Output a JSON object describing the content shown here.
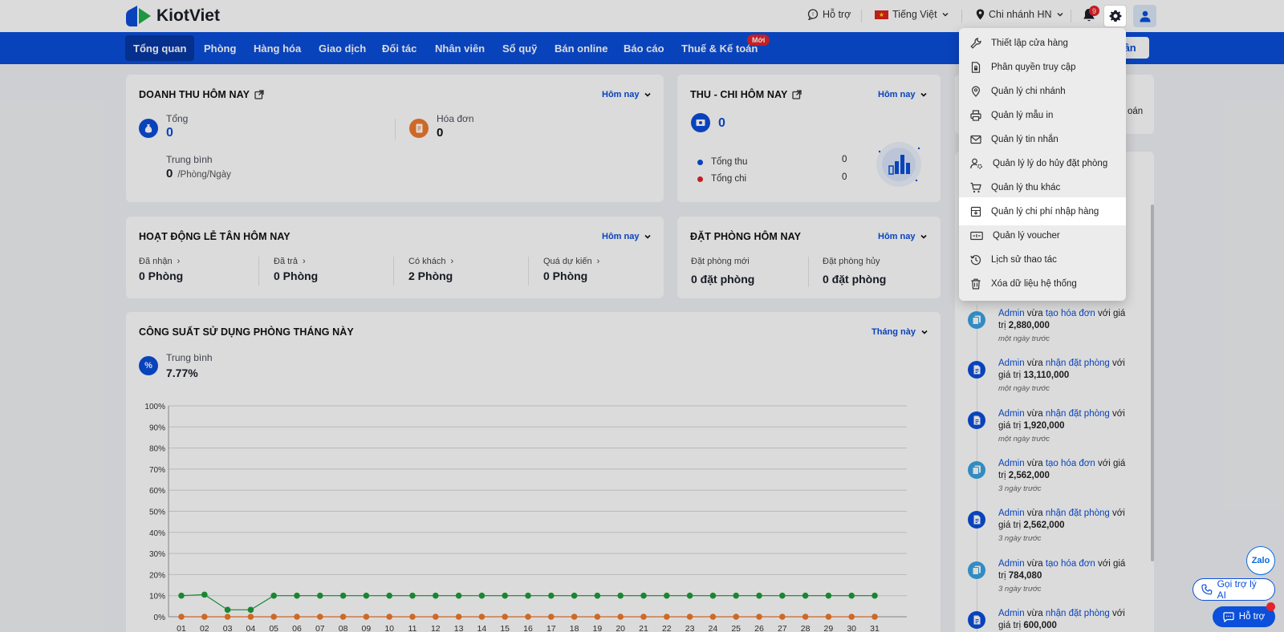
{
  "topbar": {
    "brand": "KiotViet",
    "support": "Hỗ trợ",
    "language": "Tiếng Việt",
    "branch": "Chi nhánh HN",
    "notif_count": "9"
  },
  "nav": {
    "items": [
      "Tổng quan",
      "Phòng",
      "Hàng hóa",
      "Giao dịch",
      "Đối tác",
      "Nhân viên",
      "Sổ quỹ",
      "Bán online",
      "Báo cáo",
      "Thuế & Kế toán"
    ],
    "new_badge": "Mới",
    "right_button": "tân"
  },
  "revenue": {
    "title": "DOANH THU HÔM NAY",
    "period": "Hôm nay",
    "total_label": "Tổng",
    "total_value": "0",
    "invoice_label": "Hóa đơn",
    "invoice_value": "0",
    "avg_label": "Trung bình",
    "avg_value": "0",
    "avg_unit": "/Phòng/Ngày"
  },
  "cashflow": {
    "title": "THU - CHI HÔM NAY",
    "period": "Hôm nay",
    "value": "0",
    "income_label": "Tổng thu",
    "income_value": "0",
    "expense_label": "Tổng chi",
    "expense_value": "0",
    "income_color": "#0b4fdb",
    "expense_color": "#e5232a"
  },
  "frontdesk": {
    "title": "HOẠT ĐỘNG LỄ TÂN HÔM NAY",
    "period": "Hôm nay",
    "items": [
      {
        "label": "Đã nhận",
        "value": "0 Phòng"
      },
      {
        "label": "Đã trả",
        "value": "0 Phòng"
      },
      {
        "label": "Có khách",
        "value": "2 Phòng"
      },
      {
        "label": "Quá dự kiến",
        "value": "0 Phòng"
      }
    ]
  },
  "booking": {
    "title": "ĐẶT PHÒNG HÔM NAY",
    "period": "Hôm nay",
    "new_label": "Đặt phòng mới",
    "new_value": "0 đặt phòng",
    "cancel_label": "Đặt phòng hủy",
    "cancel_value": "0 đặt phòng"
  },
  "occupancy": {
    "title": "CÔNG SUẤT SỬ DỤNG PHÒNG THÁNG NÀY",
    "period": "Tháng này",
    "avg_label": "Trung bình",
    "avg_value": "7.77%"
  },
  "chart_data": {
    "type": "line",
    "x": [
      "01",
      "02",
      "03",
      "04",
      "05",
      "06",
      "07",
      "08",
      "09",
      "10",
      "11",
      "12",
      "13",
      "14",
      "15",
      "16",
      "17",
      "18",
      "19",
      "20",
      "21",
      "22",
      "23",
      "24",
      "25",
      "26",
      "27",
      "28",
      "29",
      "30",
      "31"
    ],
    "yticks": [
      "0%",
      "10%",
      "20%",
      "30%",
      "40%",
      "50%",
      "60%",
      "70%",
      "80%",
      "90%",
      "100%"
    ],
    "ylim": [
      0,
      100
    ],
    "grid": true,
    "series": [
      {
        "color": "#1e9e3a",
        "values": [
          10,
          10.5,
          3.3,
          3.3,
          10,
          10,
          10,
          10,
          10,
          10,
          10,
          10,
          10,
          10,
          10,
          10,
          10,
          10,
          10,
          10,
          10,
          10,
          10,
          10,
          10,
          10,
          10,
          10,
          10,
          10,
          10
        ]
      },
      {
        "color": "#f07a2e",
        "values": [
          0,
          0,
          0,
          0,
          0,
          0,
          0,
          0,
          0,
          0,
          0,
          0,
          0,
          0,
          0,
          0,
          0,
          0,
          0,
          0,
          0,
          0,
          0,
          0,
          0,
          0,
          0,
          0,
          0,
          0,
          0
        ]
      }
    ]
  },
  "right_panel": {
    "top_text": "oán"
  },
  "settings_menu": {
    "items": [
      {
        "label": "Thiết lập cửa hàng",
        "icon": "wrench-icon"
      },
      {
        "label": "Phân quyền truy cập",
        "icon": "file-lock-icon"
      },
      {
        "label": "Quản lý chi nhánh",
        "icon": "map-pin-icon"
      },
      {
        "label": "Quản lý mẫu in",
        "icon": "printer-icon"
      },
      {
        "label": "Quản lý tin nhắn",
        "icon": "mail-icon"
      },
      {
        "label": "Quản lý lý do hủy đặt phòng",
        "icon": "user-gear-icon"
      },
      {
        "label": "Quản lý thu khác",
        "icon": "cart-icon"
      },
      {
        "label": "Quản lý chi phí nhập hàng",
        "icon": "box-icon"
      },
      {
        "label": "Quản lý voucher",
        "icon": "voucher-icon"
      },
      {
        "label": "Lịch sử thao tác",
        "icon": "history-icon"
      },
      {
        "label": "Xóa dữ liệu hệ thống",
        "icon": "trash-icon"
      }
    ]
  },
  "activity": [
    {
      "actor": "Admin",
      "pre": " vừa ",
      "action": "tạo hóa đơn",
      "mid": " với giá trị ",
      "amount": "2,880,000",
      "time": "một ngày trước",
      "kind": "invoice"
    },
    {
      "actor": "Admin",
      "pre": " vừa ",
      "action": "nhận đặt phòng",
      "mid": " với giá trị ",
      "amount": "13,110,000",
      "time": "một ngày trước",
      "kind": "booking"
    },
    {
      "actor": "Admin",
      "pre": " vừa ",
      "action": "nhận đặt phòng",
      "mid": " với giá trị ",
      "amount": "1,920,000",
      "time": "một ngày trước",
      "kind": "booking"
    },
    {
      "actor": "Admin",
      "pre": " vừa ",
      "action": "tạo hóa đơn",
      "mid": " với giá trị ",
      "amount": "2,562,000",
      "time": "3 ngày trước",
      "kind": "invoice"
    },
    {
      "actor": "Admin",
      "pre": " vừa ",
      "action": "nhận đặt phòng",
      "mid": " với giá trị ",
      "amount": "2,562,000",
      "time": "3 ngày trước",
      "kind": "booking"
    },
    {
      "actor": "Admin",
      "pre": " vừa ",
      "action": "tạo hóa đơn",
      "mid": " với giá trị ",
      "amount": "784,080",
      "time": "3 ngày trước",
      "kind": "invoice"
    },
    {
      "actor": "Admin",
      "pre": " vừa ",
      "action": "nhận đặt phòng",
      "mid": " với giá trị ",
      "amount": "600,000",
      "time": "",
      "kind": "booking"
    }
  ],
  "floating": {
    "zalo": "Zalo",
    "ai_support": "Gọi trợ lý AI",
    "support": "Hỗ trợ"
  }
}
